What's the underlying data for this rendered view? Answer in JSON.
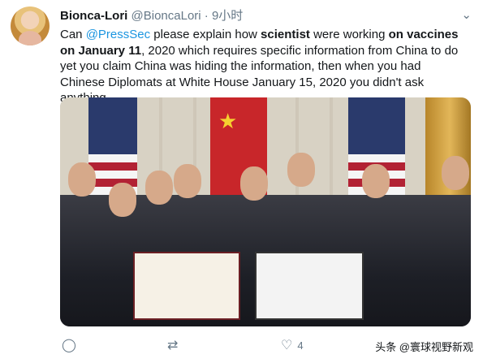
{
  "tweet": {
    "author_name": "Bionca-Lori",
    "author_handle": "@BioncaLori",
    "separator": "·",
    "time": "9小时",
    "text_parts": {
      "p1": "Can ",
      "mention": "@PressSec",
      "p2": " please explain how ",
      "b1": "scientist",
      "p3": " were working ",
      "b2": "on vaccines on January 11",
      "p4": ", 2020 which requires specific information from China to do yet you claim China was hiding the information, then when you had Chinese Diplomats at White House January 15, 2020 you didn't ask anything"
    }
  },
  "actions": {
    "reply_icon": "reply-icon",
    "retweet_icon": "retweet-icon",
    "like_icon": "heart-icon",
    "like_count": "4",
    "share_icon": "share-icon"
  },
  "watermark": "头条 @寰球视野新观",
  "colors": {
    "link": "#1b95e0",
    "muted": "#657786"
  }
}
